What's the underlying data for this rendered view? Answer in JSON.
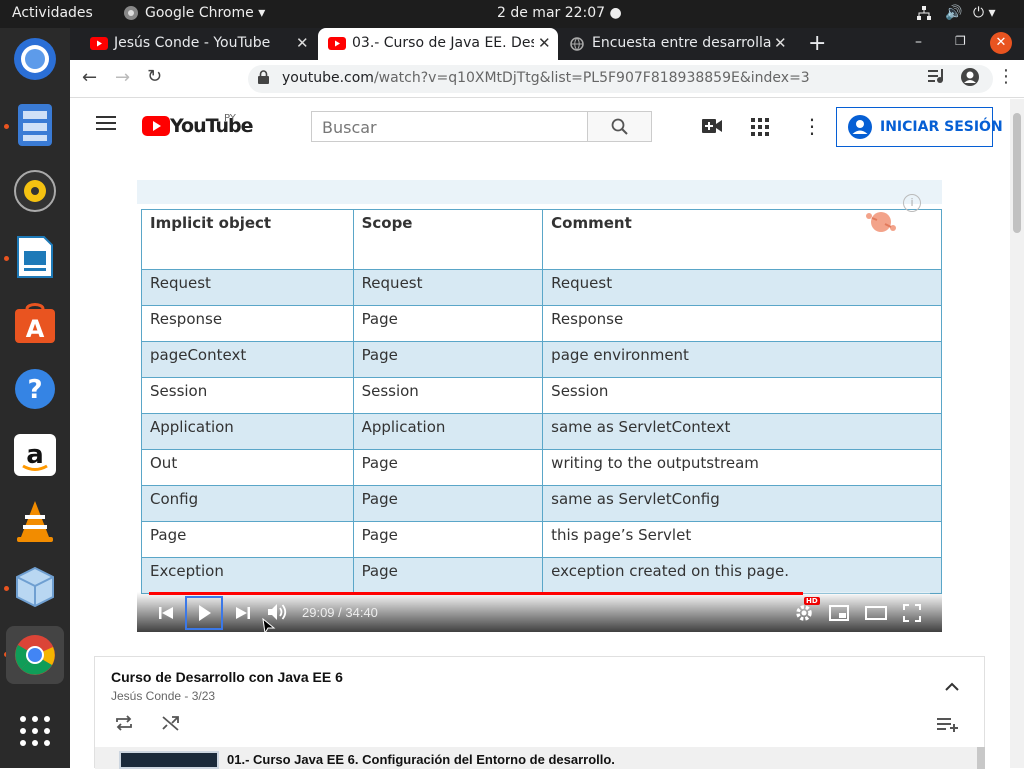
{
  "gnome": {
    "activities": "Actividades",
    "app_name": "Google Chrome",
    "clock": "2 de mar  22:07"
  },
  "browser": {
    "tabs": [
      {
        "title": "Jesús Conde - YouTube"
      },
      {
        "title": "03.- Curso de Java EE. Des"
      },
      {
        "title": "Encuesta entre desarrolla"
      }
    ],
    "url_host": "youtube.com",
    "url_path": "/watch?v=q10XMtDjTtg&list=PL5F907F818938859E&index=3"
  },
  "youtube": {
    "logo": "YouTube",
    "country": "PY",
    "search_placeholder": "Buscar",
    "signin_label": "INICIAR SESIÓN"
  },
  "video": {
    "table_headers": [
      "Implicit object",
      "Scope",
      "Comment"
    ],
    "table_rows": [
      [
        "Request",
        "Request",
        "Request"
      ],
      [
        "Response",
        "Page",
        "Response"
      ],
      [
        "pageContext",
        "Page",
        "page environment"
      ],
      [
        "Session",
        "Session",
        "Session"
      ],
      [
        "Application",
        "Application",
        "same as ServletContext"
      ],
      [
        "Out",
        "Page",
        "writing to the outputstream"
      ],
      [
        "Config",
        "Page",
        "same as ServletConfig"
      ],
      [
        "Page",
        "Page",
        "this page’s Servlet"
      ],
      [
        "Exception",
        "Page",
        "exception created on this page."
      ]
    ],
    "time": "29:09 / 34:40",
    "progress": 0.838,
    "hd_badge": "HD",
    "info_glyph": "i"
  },
  "playlist": {
    "title": "Curso de Desarrollo con Java EE 6",
    "subtitle": "Jesús Conde - 3/23",
    "first_item": "01.- Curso Java EE 6. Configuración del Entorno de desarrollo."
  }
}
